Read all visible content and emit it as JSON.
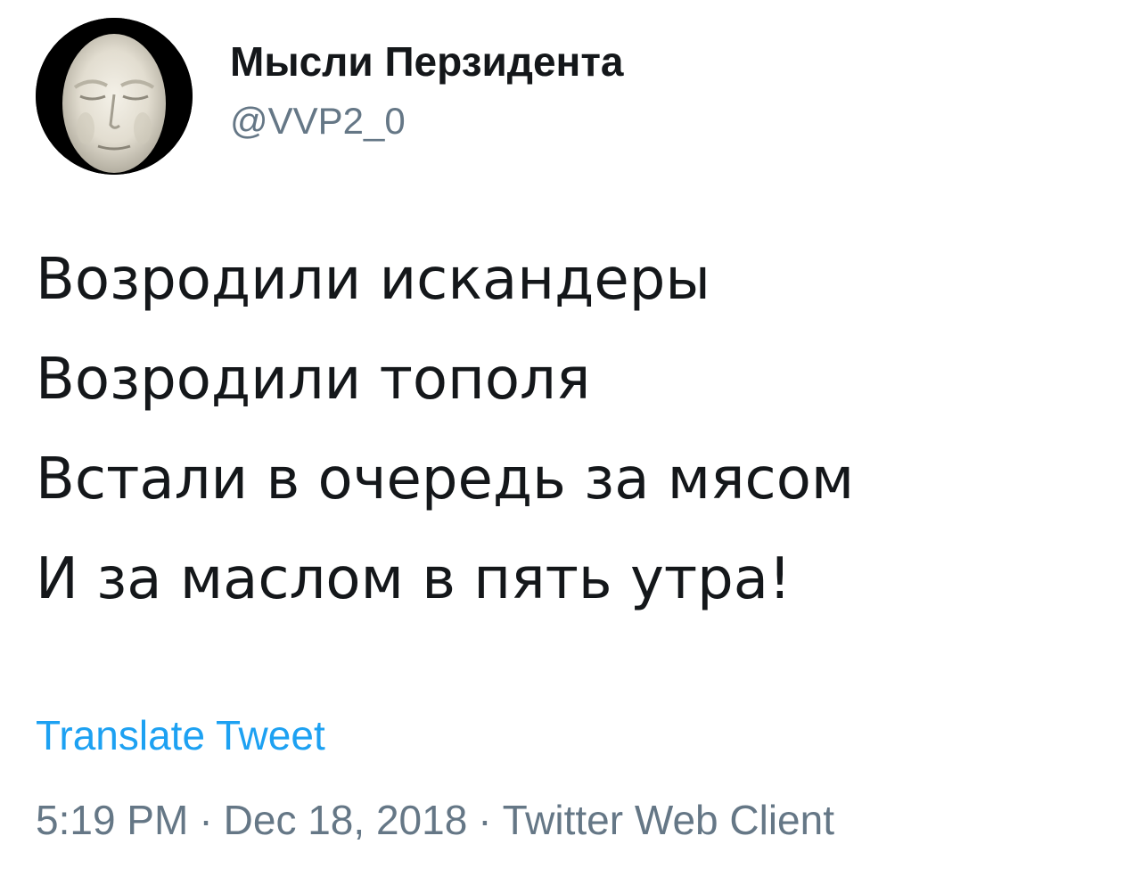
{
  "author": {
    "display_name": "Мысли Перзидента",
    "handle": "@VVP2_0",
    "avatar_icon": "plaster-face-mask-avatar"
  },
  "tweet": {
    "lines": [
      "Возродили искандеры",
      "Возродили тополя",
      "Встали в очередь за мясом",
      "И за маслом в пять утра!"
    ],
    "translate_label": "Translate Tweet",
    "time": "5:19 PM",
    "date": "Dec 18, 2018",
    "separator": "·",
    "client": "Twitter Web Client"
  },
  "colors": {
    "text": "#14171a",
    "secondary": "#657786",
    "link": "#1da1f2",
    "background": "#ffffff"
  }
}
